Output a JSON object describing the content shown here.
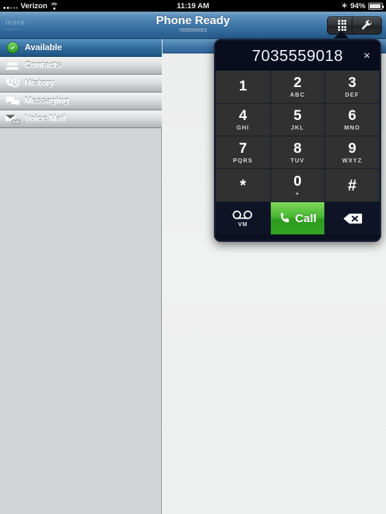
{
  "status_bar": {
    "carrier": "Verizon",
    "time": "11:19 AM",
    "battery_percent": "94%",
    "wifi_icon": "wifi-icon",
    "bluetooth_icon": "bluetooth-icon",
    "battery_icon": "battery-icon",
    "signal_icon": "signal-strength-icon"
  },
  "navbar": {
    "logo": "icore",
    "logo_sub": "networks",
    "title": "Phone Ready",
    "subtitle": "7035550001",
    "dialpad_button": "dialpad-icon",
    "settings_button": "wrench-icon"
  },
  "sidebar": {
    "items": [
      {
        "label": "Available",
        "icon": "check-circle-icon",
        "selected": true
      },
      {
        "label": "Contacts",
        "icon": "contacts-icon",
        "selected": false
      },
      {
        "label": "History",
        "icon": "history-icon",
        "selected": false
      },
      {
        "label": "Messaging",
        "icon": "messaging-icon",
        "selected": false
      },
      {
        "label": "Voice Mail",
        "icon": "voicemail-envelope-icon",
        "selected": false
      }
    ]
  },
  "dialpad": {
    "number": "7035559018",
    "close_label": "×",
    "keys": [
      {
        "digit": "1",
        "letters": ""
      },
      {
        "digit": "2",
        "letters": "ABC"
      },
      {
        "digit": "3",
        "letters": "DEF"
      },
      {
        "digit": "4",
        "letters": "GHI"
      },
      {
        "digit": "5",
        "letters": "JKL"
      },
      {
        "digit": "6",
        "letters": "MNO"
      },
      {
        "digit": "7",
        "letters": "PQRS"
      },
      {
        "digit": "8",
        "letters": "TUV"
      },
      {
        "digit": "9",
        "letters": "WXYZ"
      },
      {
        "digit": "*",
        "letters": ""
      },
      {
        "digit": "0",
        "letters": "+"
      },
      {
        "digit": "#",
        "letters": ""
      }
    ],
    "voicemail_label": "VM",
    "call_label": "Call",
    "backspace_icon": "backspace-icon",
    "call_accent": "#3aa82a"
  },
  "colors": {
    "navbar_blue": "#3f77a9",
    "sidebar_bg": "#d2d4d7",
    "content_bg": "#eff0f0",
    "popover_bg": "#0b1020",
    "key_bg": "#313131"
  }
}
